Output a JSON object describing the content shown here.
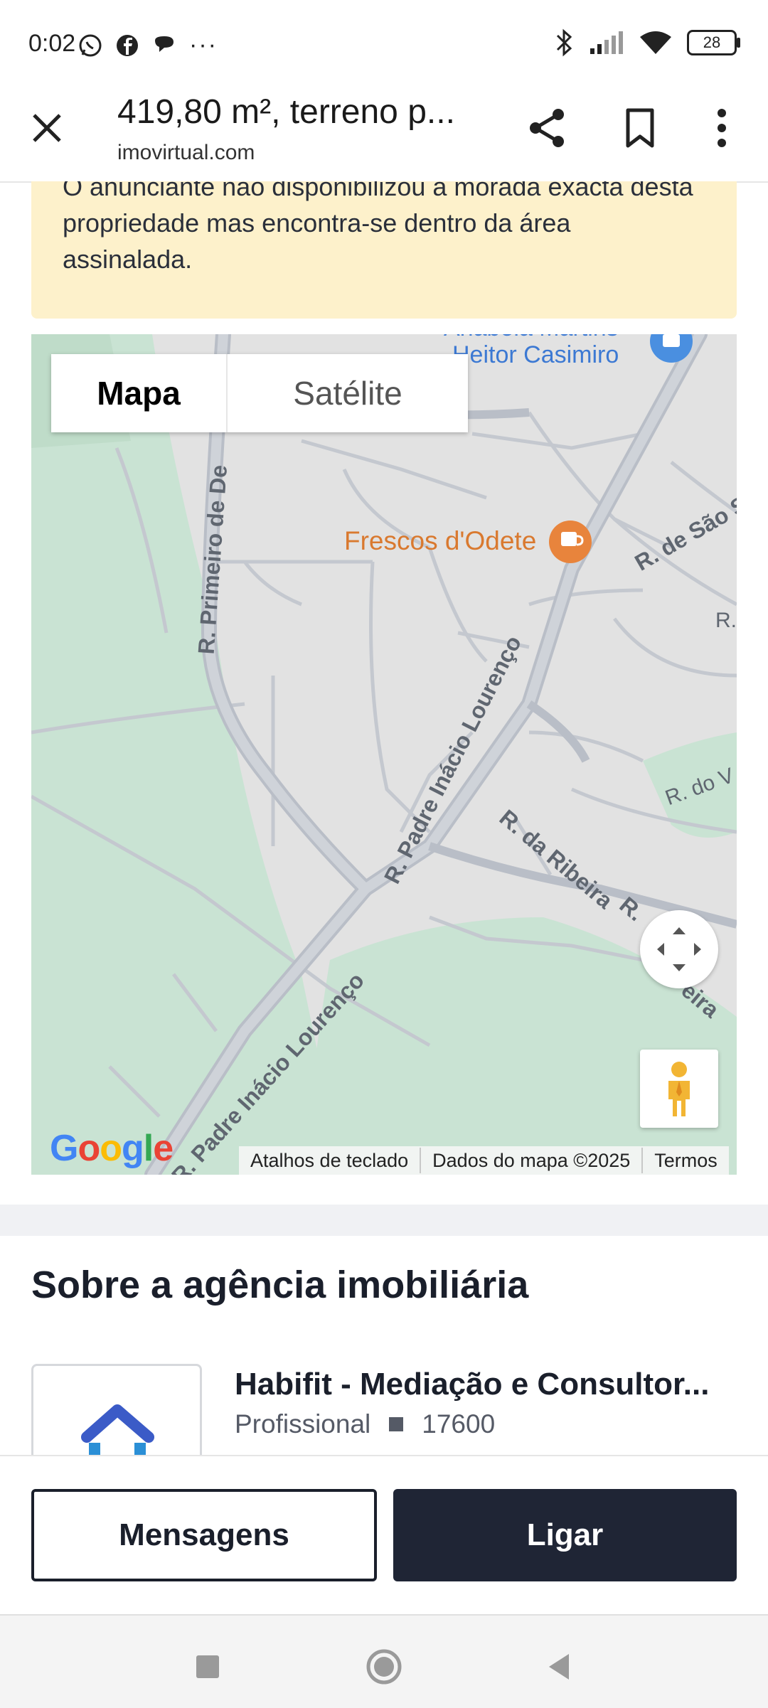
{
  "status_bar": {
    "time": "0:02",
    "more": "···",
    "battery": "28"
  },
  "appbar": {
    "title": "419,80 m², terreno p...",
    "subtitle": "imovirtual.com"
  },
  "notice": {
    "text": "O anunciante não disponibilizou a morada exacta desta propriedade mas encontra-se dentro da área assinalada."
  },
  "map": {
    "tabs": [
      {
        "label": "Mapa",
        "active": true
      },
      {
        "label": "Satélite",
        "active": false
      }
    ],
    "places": {
      "store": "Heitor Casimiro",
      "store_top": "Anabela Martins",
      "cafe": "Frescos d'Odete"
    },
    "streets": {
      "primeiro": "R. Primeiro de De",
      "padre_upper": "R. Padre Inácio Lourenço",
      "padre_lower": "R. Padre Inácio Lourenço",
      "ribeira": "R. da Ribeira",
      "sao": "R. de São S",
      "r_right": "R.",
      "do_v": "R. do V",
      "r_ribeira2": "R.",
      "eira": "eira"
    },
    "google_logo": "Google",
    "footer": [
      "Atalhos de teclado",
      "Dados do mapa ©2025",
      "Termos"
    ]
  },
  "agency": {
    "section_title": "Sobre a agência imobiliária",
    "name": "Habifit - Mediação e Consultor...",
    "type": "Profissional",
    "id": "17600"
  },
  "actions": {
    "messages_label": "Mensagens",
    "call_label": "Ligar"
  },
  "colors": {
    "accent_dark": "#1f2535",
    "notice_bg": "#fdf1cb",
    "map_green": "#c8e6d2",
    "cafe_orange": "#e8843c"
  }
}
